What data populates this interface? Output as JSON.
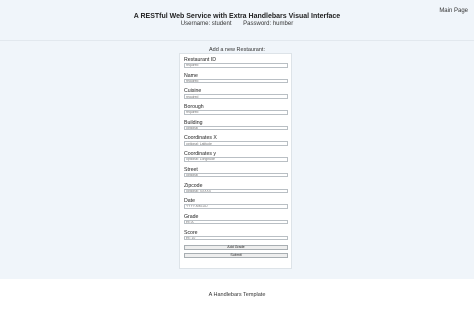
{
  "header": {
    "main_page_link": "Main Page",
    "title": "A RESTful Web Service with Extra Handlebars Visual Interface",
    "username": "Username: student",
    "password": "Password: humber"
  },
  "form": {
    "heading": "Add a new Restaurant:",
    "fields": [
      {
        "label": "Restaurant ID",
        "placeholder": "required"
      },
      {
        "label": "Name",
        "placeholder": "required"
      },
      {
        "label": "Cuisine",
        "placeholder": "required"
      },
      {
        "label": "Borough",
        "placeholder": "required"
      },
      {
        "label": "Building",
        "placeholder": "optional"
      },
      {
        "label": "Coordinates X",
        "placeholder": "optional: Latitude"
      },
      {
        "label": "Coordinates y",
        "placeholder": "optional: LongItude"
      },
      {
        "label": "Street",
        "placeholder": "optional"
      },
      {
        "label": "Zipcode",
        "placeholder": "optional: XXXXX"
      },
      {
        "label": "Date",
        "placeholder": "YYYY-MM-DD"
      },
      {
        "label": "Grade",
        "placeholder": "ex: A"
      },
      {
        "label": "Score",
        "placeholder": "ex: 10"
      }
    ],
    "add_grade_label": "Add Grade",
    "submit_label": "Submit"
  },
  "footer": {
    "text": "A Handlebars Template"
  }
}
